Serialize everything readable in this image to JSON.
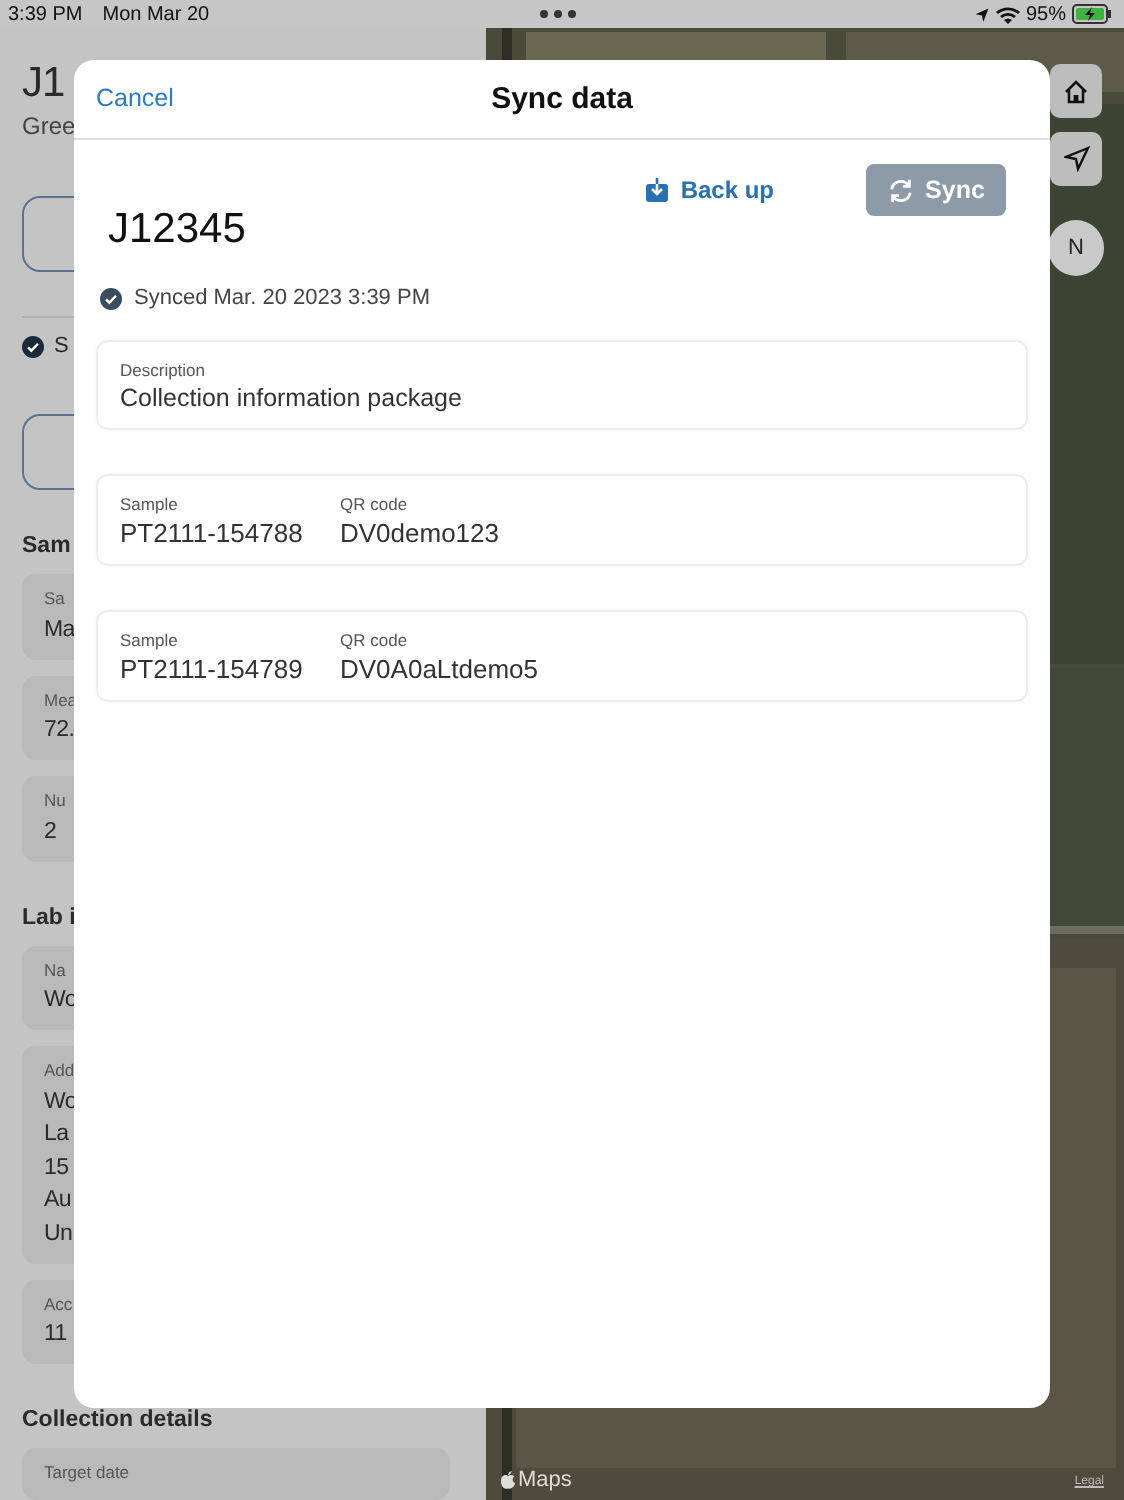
{
  "status_bar": {
    "time": "3:39 PM",
    "date": "Mon Mar 20",
    "battery": "95%"
  },
  "background": {
    "items": [
      {
        "kind": "title",
        "text": "J1"
      },
      {
        "kind": "subtitle",
        "text": "Gree"
      },
      {
        "kind": "outline-button"
      },
      {
        "kind": "status",
        "text": "S"
      },
      {
        "kind": "outline-button"
      },
      {
        "kind": "section",
        "text": "Sam"
      },
      {
        "kind": "field",
        "label": "Sa",
        "lines": [
          "Ma"
        ]
      },
      {
        "kind": "field",
        "label": "Mea",
        "lines": [
          "72."
        ]
      },
      {
        "kind": "field",
        "label": "Nu",
        "lines": [
          "2"
        ]
      },
      {
        "kind": "section",
        "text": "Lab i"
      },
      {
        "kind": "field",
        "label": "Na",
        "lines": [
          "Wo"
        ]
      },
      {
        "kind": "field",
        "label": "Add",
        "lines": [
          "Wo",
          "La",
          "15",
          "Au",
          "Un"
        ]
      },
      {
        "kind": "field",
        "label": "Acc",
        "lines": [
          "11"
        ]
      },
      {
        "kind": "section",
        "text": "Collection details"
      },
      {
        "kind": "field",
        "label": "Target date"
      }
    ]
  },
  "map": {
    "kind": "picture",
    "compass": "N",
    "attribution": "Maps",
    "legal": "Legal"
  },
  "modal": {
    "cancel": "Cancel",
    "title": "Sync data",
    "backup": "Back up",
    "sync": {
      "label": "Sync",
      "disabled": true
    },
    "job": "J12345",
    "synced": "Synced Mar. 20 2023 3:39 PM",
    "description": {
      "label": "Description",
      "value": "Collection information package"
    },
    "samples": [
      {
        "sample_label": "Sample",
        "sample": "PT2111-154788",
        "qr_label": "QR code",
        "qr": "DV0demo123"
      },
      {
        "sample_label": "Sample",
        "sample": "PT2111-154789",
        "qr_label": "QR code",
        "qr": "DV0A0aLtdemo5"
      }
    ]
  }
}
